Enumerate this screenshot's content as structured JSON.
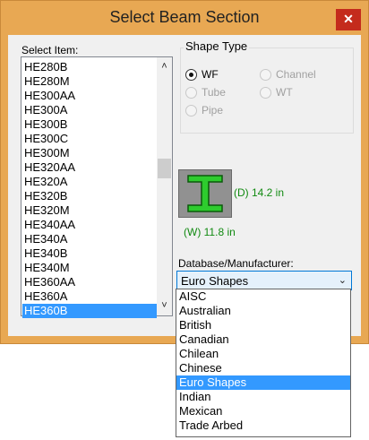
{
  "window": {
    "title": "Select  Beam Section",
    "close_glyph": "✕"
  },
  "list": {
    "label": "Select Item:",
    "items": [
      "HE280B",
      "HE280M",
      "HE300AA",
      "HE300A",
      "HE300B",
      "HE300C",
      "HE300M",
      "HE320AA",
      "HE320A",
      "HE320B",
      "HE320M",
      "HE340AA",
      "HE340A",
      "HE340B",
      "HE340M",
      "HE360AA",
      "HE360A",
      "HE360B"
    ],
    "selected": "HE360B"
  },
  "shape_type": {
    "label": "Shape Type",
    "options": [
      {
        "label": "WF",
        "checked": true,
        "enabled": true
      },
      {
        "label": "Channel",
        "checked": false,
        "enabled": false
      },
      {
        "label": "Tube",
        "checked": false,
        "enabled": false
      },
      {
        "label": "WT",
        "checked": false,
        "enabled": false
      },
      {
        "label": "Pipe",
        "checked": false,
        "enabled": false
      }
    ]
  },
  "section": {
    "depth_label": "(D) 14.2 in",
    "width_label": "(W) 11.8 in",
    "icon": "i-beam-icon",
    "accent_color": "#118a11"
  },
  "database": {
    "label": "Database/Manufacturer:",
    "selected": "Euro Shapes",
    "options": [
      "AISC",
      "Australian",
      "British",
      "Canadian",
      "Chilean",
      "Chinese",
      "Euro Shapes",
      "Indian",
      "Mexican",
      "Trade Arbed"
    ]
  }
}
